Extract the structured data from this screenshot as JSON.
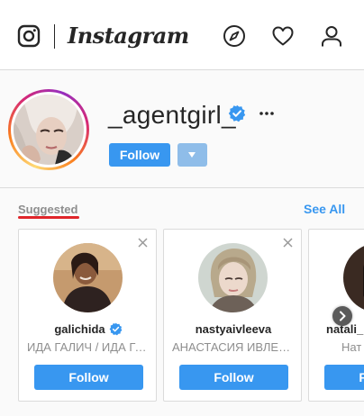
{
  "header": {
    "wordmark": "Instagram",
    "icons": [
      "instagram-camera-icon",
      "explore-compass-icon",
      "heart-icon",
      "profile-person-icon"
    ]
  },
  "profile": {
    "username": "_agentgirl_",
    "verified": true,
    "follow_label": "Follow"
  },
  "suggested": {
    "title": "Suggested",
    "see_all": "See All",
    "cards": [
      {
        "username": "galichida",
        "verified": true,
        "subtitle": "ИДА ГАЛИЧ / ИДА ГАЛИЧ",
        "follow_label": "Follow"
      },
      {
        "username": "nastyaivleeva",
        "verified": false,
        "subtitle": "АНАСТАСИЯ ИВЛЕЕВА",
        "follow_label": "Follow"
      },
      {
        "username": "natali_",
        "verified": false,
        "subtitle": "Нат",
        "follow_label": "Follow"
      }
    ]
  },
  "colors": {
    "accent_blue": "#3897f0",
    "accent_blue_light": "#8fbde9",
    "underline_red": "#e0262b",
    "muted_text": "#8e8e8e",
    "border": "#dbdbdb"
  }
}
